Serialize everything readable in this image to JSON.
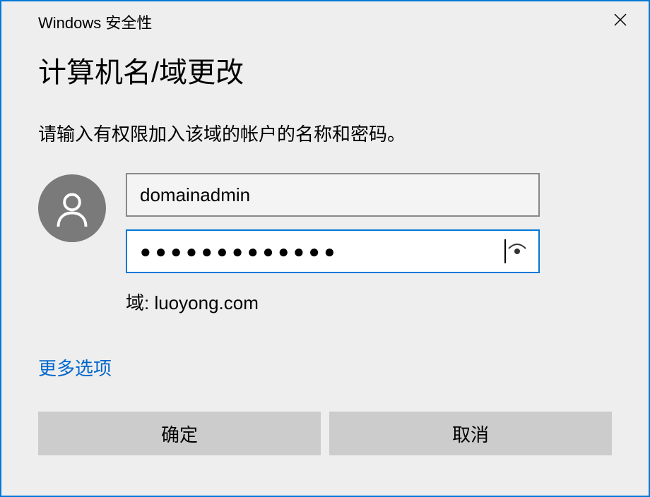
{
  "titlebar": {
    "title": "Windows 安全性"
  },
  "dialog": {
    "heading": "计算机名/域更改",
    "instruction": "请输入有权限加入该域的帐户的名称和密码。",
    "username_value": "domainadmin",
    "password_masked": "●●●●●●●●●●●●●",
    "domain_label": "域: luoyong.com",
    "more_options": "更多选项",
    "ok_label": "确定",
    "cancel_label": "取消"
  }
}
